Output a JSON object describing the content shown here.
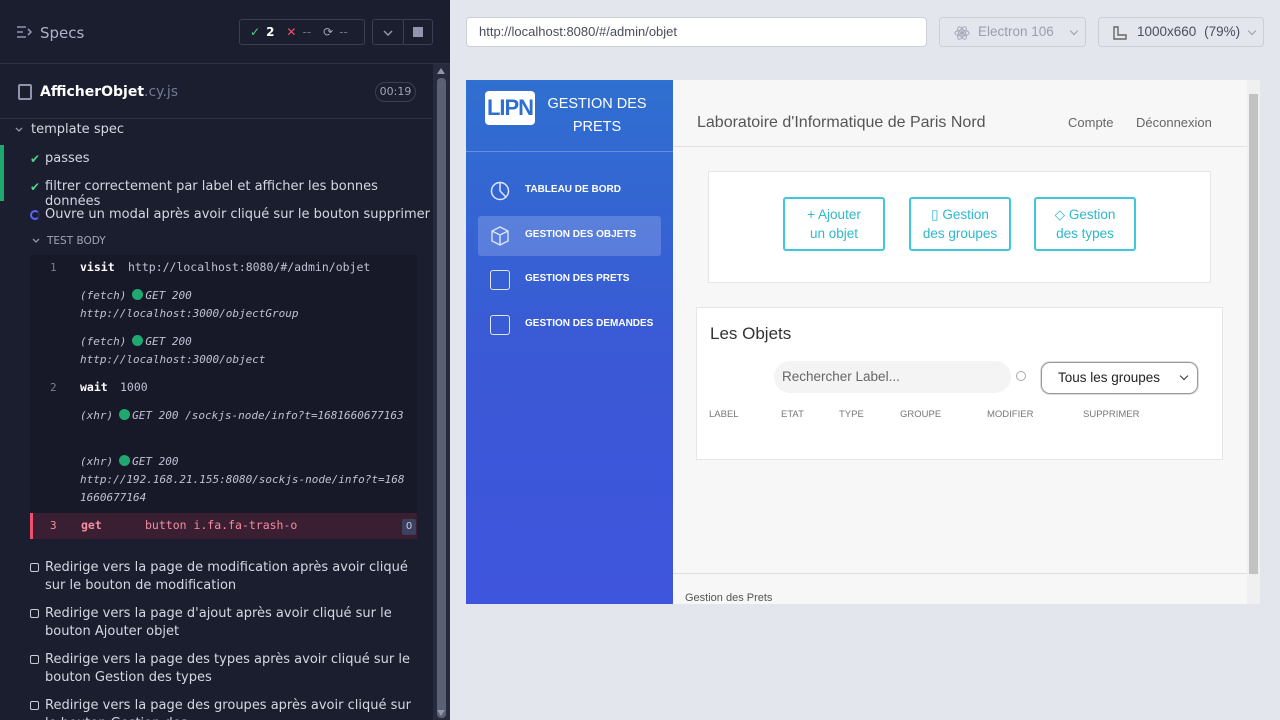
{
  "runner": {
    "header": {
      "title": "Specs",
      "passed_icon": "✓",
      "passed": "2",
      "failed_icon": "✕",
      "failed": "--",
      "pending_icon": "⟳",
      "pending": "--"
    },
    "file": {
      "name": "AfficherObjet",
      "ext": ".cy.js",
      "time": "00:19"
    },
    "suite": "template spec",
    "tests": [
      {
        "label": "passes",
        "state": "passed"
      },
      {
        "label": "filtrer correctement par label et afficher les bonnes données",
        "state": "passed"
      },
      {
        "label": "Ouvre un modal après avoir cliqué sur le bouton supprimer",
        "state": "running"
      }
    ],
    "test_body": "TEST BODY",
    "commands": {
      "c1": {
        "num": "1",
        "name": "visit",
        "arg": "http://localhost:8080/#/admin/objet"
      },
      "l1": {
        "type": "(fetch)",
        "status": "GET 200",
        "url": "http://localhost:3000/objectGroup"
      },
      "l2": {
        "type": "(fetch)",
        "status": "GET 200",
        "url": "http://localhost:3000/object"
      },
      "c2": {
        "num": "2",
        "name": "wait",
        "arg": "1000"
      },
      "l3": {
        "type": "(xhr)",
        "status": "GET 200",
        "url": "/sockjs-node/info?t=1681660677163"
      },
      "l4": {
        "type": "(xhr)",
        "status": "GET 200",
        "url": "http://192.168.21.155:8080/sockjs-node/info?t=1681660677164"
      },
      "c3": {
        "num": "3",
        "name": "get",
        "arg": "button i.fa.fa-trash-o",
        "count": "0"
      }
    },
    "pending_tests": [
      "Redirige vers la page de modification après avoir cliqué sur le bouton de modification",
      "Redirige vers la page d'ajout après avoir cliqué sur le bouton Ajouter objet",
      "Redirige vers la page des types après avoir cliqué sur le bouton Gestion des types",
      "Redirige vers la page des groupes après avoir cliqué sur le bouton Gestion des"
    ]
  },
  "browser": {
    "url": "http://localhost:8080/#/admin/objet",
    "engine": "Electron 106",
    "viewport": "1000x660",
    "zoom": "(79%)"
  },
  "app": {
    "logo": "LIPN",
    "brand": "GESTION DES PRETS",
    "nav": [
      "TABLEAU DE BORD",
      "GESTION DES OBJETS",
      "GESTION DES PRETS",
      "GESTION DES DEMANDES"
    ],
    "lab_title": "Laboratoire d'Informatique de Paris Nord",
    "compte": "Compte",
    "deconnexion": "Déconnexion",
    "buttons": {
      "add_line1": "+ Ajouter",
      "add_line2": "un objet",
      "groups_line1": "Gestion",
      "groups_line2": "des groupes",
      "types_line1": "Gestion",
      "types_line2": "des types"
    },
    "objects_title": "Les Objets",
    "search_placeholder": "Rechercher Label...",
    "group_select": "Tous les groupes",
    "columns": [
      "LABEL",
      "ETAT",
      "TYPE",
      "GROUPE",
      "MODIFIER",
      "SUPPRIMER"
    ],
    "footer": "Gestion des Prets"
  },
  "colors": {
    "runner_bg": "#1b1e2e",
    "pass_green": "#4bd58a",
    "fail_red": "#f0506e",
    "sidebar_blue": "#3b58d6",
    "accent_cyan": "#41c7dd"
  }
}
